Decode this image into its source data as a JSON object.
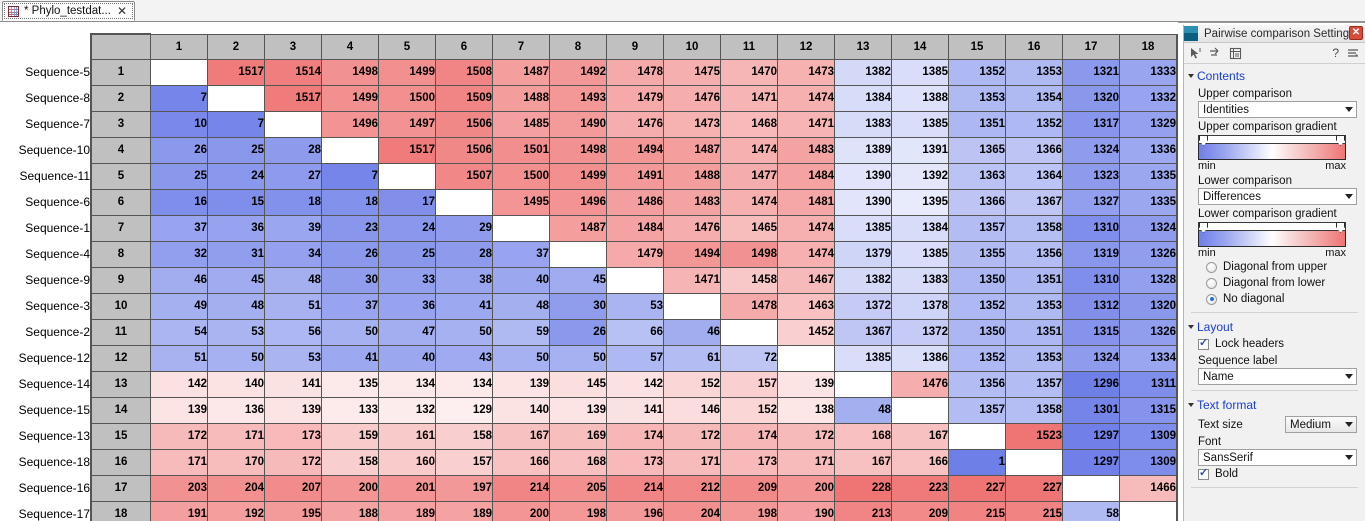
{
  "tab": {
    "title": "* Phylo_testdat...",
    "icon": "grid-icon",
    "close": "✕"
  },
  "panel": {
    "title": "Pairwise comparison Settings",
    "close_label": "✕",
    "help_label": "?",
    "sections": {
      "contents": {
        "label": "Contents",
        "upper_comparison_label": "Upper comparison",
        "upper_comparison_value": "Identities",
        "upper_gradient_label": "Upper comparison gradient",
        "lower_comparison_label": "Lower comparison",
        "lower_comparison_value": "Differences",
        "lower_gradient_label": "Lower comparison gradient",
        "min_label": "min",
        "max_label": "max",
        "diagonal_options": [
          {
            "label": "Diagonal from upper",
            "selected": false
          },
          {
            "label": "Diagonal from lower",
            "selected": false
          },
          {
            "label": "No diagonal",
            "selected": true
          }
        ]
      },
      "layout": {
        "label": "Layout",
        "lock_headers_label": "Lock headers",
        "lock_headers_checked": true,
        "sequence_label_label": "Sequence label",
        "sequence_label_value": "Name"
      },
      "text_format": {
        "label": "Text format",
        "text_size_label": "Text size",
        "text_size_value": "Medium",
        "font_label": "Font",
        "font_value": "SansSerif",
        "bold_label": "Bold",
        "bold_checked": true
      }
    },
    "colors": {
      "gradient_min": "#6f7fe8",
      "gradient_mid": "#ffffff",
      "gradient_max": "#ef7474",
      "section_heading": "#1a3fd0",
      "close_button": "#d94a3c"
    }
  },
  "matrix": {
    "row_labels": [
      "Sequence-5",
      "Sequence-8",
      "Sequence-7",
      "Sequence-10",
      "Sequence-11",
      "Sequence-6",
      "Sequence-1",
      "Sequence-4",
      "Sequence-9",
      "Sequence-3",
      "Sequence-2",
      "Sequence-12",
      "Sequence-14",
      "Sequence-15",
      "Sequence-13",
      "Sequence-18",
      "Sequence-16",
      "Sequence-17"
    ],
    "col_headers": [
      "1",
      "2",
      "3",
      "4",
      "5",
      "6",
      "7",
      "8",
      "9",
      "10",
      "11",
      "12",
      "13",
      "14",
      "15",
      "16",
      "17",
      "18"
    ],
    "row_headers": [
      "1",
      "2",
      "3",
      "4",
      "5",
      "6",
      "7",
      "8",
      "9",
      "10",
      "11",
      "12",
      "13",
      "14",
      "15",
      "16",
      "17",
      "18"
    ],
    "upper_type": "Identities",
    "lower_type": "Differences",
    "values": [
      [
        null,
        1517,
        1514,
        1498,
        1499,
        1508,
        1487,
        1492,
        1478,
        1475,
        1470,
        1473,
        1382,
        1385,
        1352,
        1353,
        1321,
        1333
      ],
      [
        7,
        null,
        1517,
        1499,
        1500,
        1509,
        1488,
        1493,
        1479,
        1476,
        1471,
        1474,
        1384,
        1388,
        1353,
        1354,
        1320,
        1332
      ],
      [
        10,
        7,
        null,
        1496,
        1497,
        1506,
        1485,
        1490,
        1476,
        1473,
        1468,
        1471,
        1383,
        1385,
        1351,
        1352,
        1317,
        1329
      ],
      [
        26,
        25,
        28,
        null,
        1517,
        1506,
        1501,
        1498,
        1494,
        1487,
        1474,
        1483,
        1389,
        1391,
        1365,
        1366,
        1324,
        1336
      ],
      [
        25,
        24,
        27,
        7,
        null,
        1507,
        1500,
        1499,
        1491,
        1488,
        1477,
        1484,
        1390,
        1392,
        1363,
        1364,
        1323,
        1335
      ],
      [
        16,
        15,
        18,
        18,
        17,
        null,
        1495,
        1496,
        1486,
        1483,
        1474,
        1481,
        1390,
        1395,
        1366,
        1367,
        1327,
        1335
      ],
      [
        37,
        36,
        39,
        23,
        24,
        29,
        null,
        1487,
        1484,
        1476,
        1465,
        1474,
        1385,
        1384,
        1357,
        1358,
        1310,
        1324
      ],
      [
        32,
        31,
        34,
        26,
        25,
        28,
        37,
        null,
        1479,
        1494,
        1498,
        1474,
        1379,
        1385,
        1355,
        1356,
        1319,
        1326
      ],
      [
        46,
        45,
        48,
        30,
        33,
        38,
        40,
        45,
        null,
        1471,
        1458,
        1467,
        1382,
        1383,
        1350,
        1351,
        1310,
        1328
      ],
      [
        49,
        48,
        51,
        37,
        36,
        41,
        48,
        30,
        53,
        null,
        1478,
        1463,
        1372,
        1378,
        1352,
        1353,
        1312,
        1320
      ],
      [
        54,
        53,
        56,
        50,
        47,
        50,
        59,
        26,
        66,
        46,
        null,
        1452,
        1367,
        1372,
        1350,
        1351,
        1315,
        1326
      ],
      [
        51,
        50,
        53,
        41,
        40,
        43,
        50,
        50,
        57,
        61,
        72,
        null,
        1385,
        1386,
        1352,
        1353,
        1324,
        1334
      ],
      [
        142,
        140,
        141,
        135,
        134,
        134,
        139,
        145,
        142,
        152,
        157,
        139,
        null,
        1476,
        1356,
        1357,
        1296,
        1311
      ],
      [
        139,
        136,
        139,
        133,
        132,
        129,
        140,
        139,
        141,
        146,
        152,
        138,
        48,
        null,
        1357,
        1358,
        1301,
        1315
      ],
      [
        172,
        171,
        173,
        159,
        161,
        158,
        167,
        169,
        174,
        172,
        174,
        172,
        168,
        167,
        null,
        1523,
        1297,
        1309
      ],
      [
        171,
        170,
        172,
        158,
        160,
        157,
        166,
        168,
        173,
        171,
        173,
        171,
        167,
        166,
        1,
        null,
        1297,
        1309
      ],
      [
        203,
        204,
        207,
        200,
        201,
        197,
        214,
        205,
        214,
        212,
        209,
        200,
        228,
        223,
        227,
        227,
        null,
        1466
      ],
      [
        191,
        192,
        195,
        188,
        189,
        189,
        200,
        198,
        196,
        204,
        198,
        190,
        213,
        209,
        215,
        215,
        58,
        null
      ]
    ]
  }
}
